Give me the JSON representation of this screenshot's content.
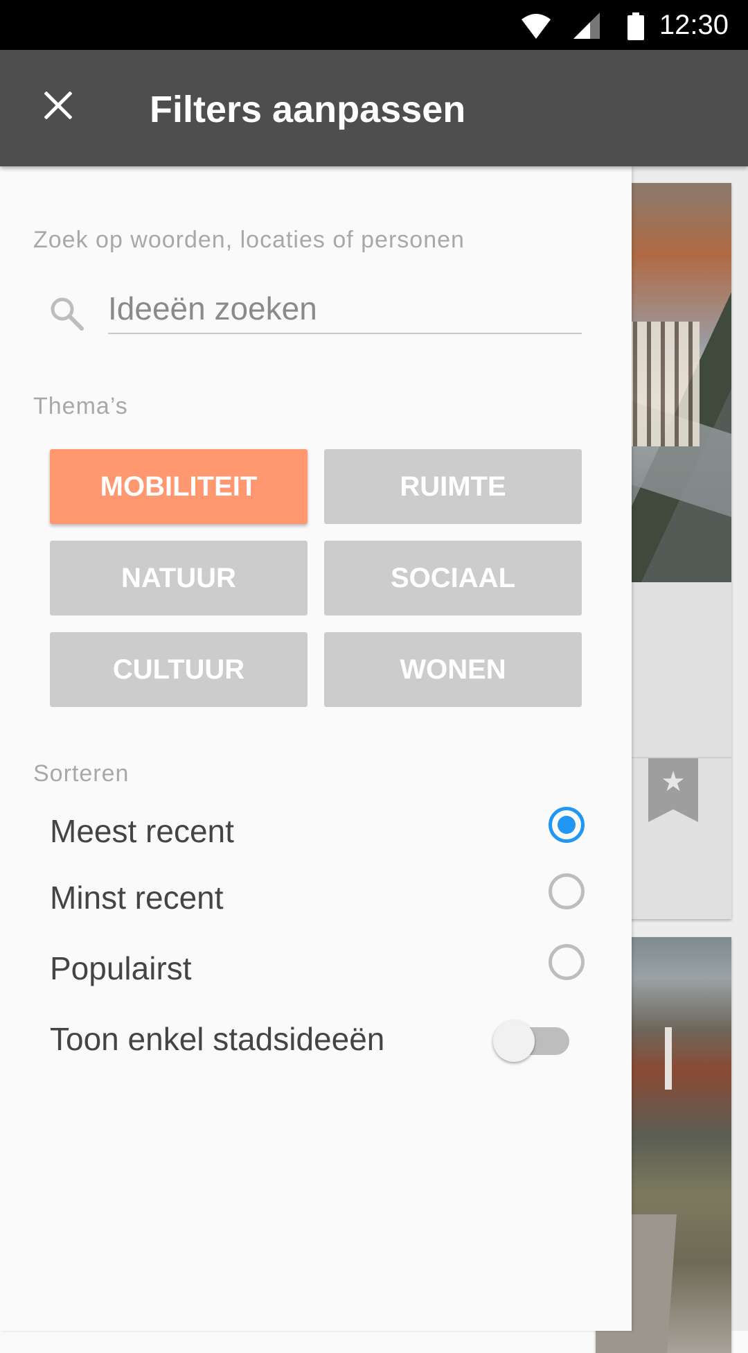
{
  "status_bar": {
    "time": "12:30",
    "icons": [
      "wifi-icon",
      "signal-icon",
      "battery-icon"
    ]
  },
  "app_bar": {
    "close_icon": "close-icon",
    "title": "Filters aanpassen",
    "background": "#4e4e4e"
  },
  "search": {
    "label": "Zoek op woorden, locaties of personen",
    "placeholder": "Ideeën zoeken",
    "value": "",
    "icon": "search-icon"
  },
  "themes": {
    "label": "Thema’s",
    "items": [
      {
        "label": "MOBILITEIT",
        "selected": true
      },
      {
        "label": "RUIMTE",
        "selected": false
      },
      {
        "label": "NATUUR",
        "selected": false
      },
      {
        "label": "SOCIAAL",
        "selected": false
      },
      {
        "label": "CULTUUR",
        "selected": false
      },
      {
        "label": "WONEN",
        "selected": false
      }
    ],
    "selected_color": "#ff9871",
    "unselected_color": "#cccccc"
  },
  "sort": {
    "label": "Sorteren",
    "options": [
      {
        "label": "Meest recent",
        "selected": true
      },
      {
        "label": "Minst recent",
        "selected": false
      },
      {
        "label": "Populairst",
        "selected": false
      }
    ],
    "accent_color": "#2196f3"
  },
  "toggle": {
    "label": "Toon enkel stadsideeën",
    "on": false
  },
  "background_cards": {
    "bookmark_icon": "star-bookmark-icon"
  }
}
